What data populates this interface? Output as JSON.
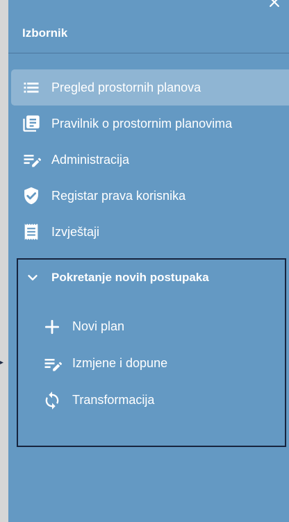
{
  "drawer": {
    "title": "Izbornik",
    "background": "#6499c3",
    "active_highlight": "rgba(255,255,255,0.28)"
  },
  "nav": {
    "items": [
      {
        "label": "Pregled prostornih planova",
        "icon": "list-icon",
        "active": true
      },
      {
        "label": "Pravilnik o prostornim planovima",
        "icon": "library-books-icon",
        "active": false
      },
      {
        "label": "Administracija",
        "icon": "edit-note-icon",
        "active": false
      },
      {
        "label": "Registar prava korisnika",
        "icon": "verified-shield-icon",
        "active": false
      },
      {
        "label": "Izvještaji",
        "icon": "receipt-icon",
        "active": false
      }
    ]
  },
  "group": {
    "label": "Pokretanje novih postupaka",
    "icon": "chevron-down-icon",
    "expanded": true,
    "border_color": "#17243e",
    "items": [
      {
        "label": "Novi plan",
        "icon": "plus-icon"
      },
      {
        "label": "Izmjene i dopune",
        "icon": "edit-note-icon"
      },
      {
        "label": "Transformacija",
        "icon": "sync-icon"
      }
    ]
  }
}
